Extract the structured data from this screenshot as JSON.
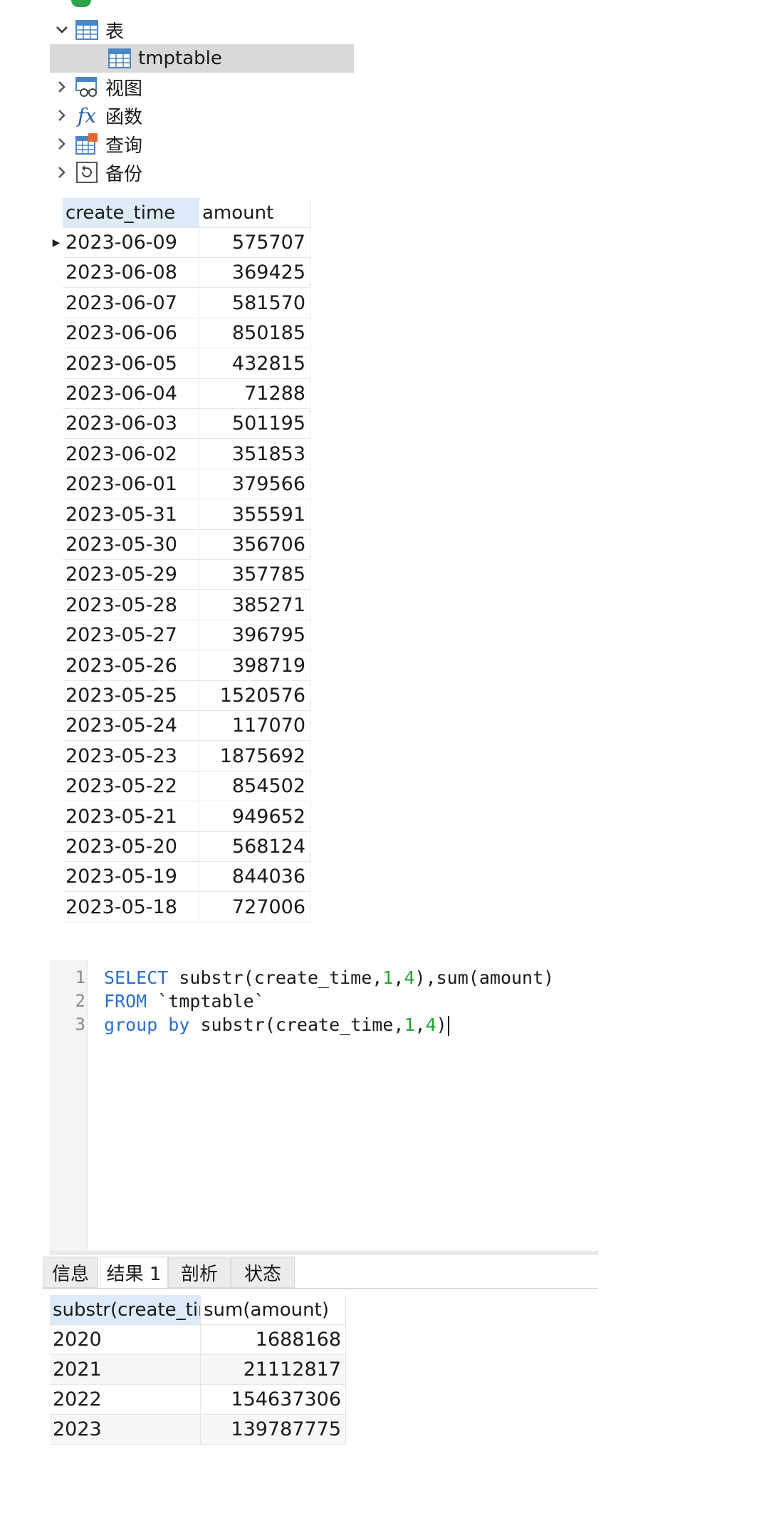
{
  "tree": {
    "tables_label": "表",
    "table_name": "tmptable",
    "views_label": "视图",
    "functions_label": "函数",
    "queries_label": "查询",
    "backups_label": "备份"
  },
  "grid": {
    "columns": [
      "create_time",
      "amount"
    ],
    "rows": [
      [
        "2023-06-09",
        "575707"
      ],
      [
        "2023-06-08",
        "369425"
      ],
      [
        "2023-06-07",
        "581570"
      ],
      [
        "2023-06-06",
        "850185"
      ],
      [
        "2023-06-05",
        "432815"
      ],
      [
        "2023-06-04",
        "71288"
      ],
      [
        "2023-06-03",
        "501195"
      ],
      [
        "2023-06-02",
        "351853"
      ],
      [
        "2023-06-01",
        "379566"
      ],
      [
        "2023-05-31",
        "355591"
      ],
      [
        "2023-05-30",
        "356706"
      ],
      [
        "2023-05-29",
        "357785"
      ],
      [
        "2023-05-28",
        "385271"
      ],
      [
        "2023-05-27",
        "396795"
      ],
      [
        "2023-05-26",
        "398719"
      ],
      [
        "2023-05-25",
        "1520576"
      ],
      [
        "2023-05-24",
        "117070"
      ],
      [
        "2023-05-23",
        "1875692"
      ],
      [
        "2023-05-22",
        "854502"
      ],
      [
        "2023-05-21",
        "949652"
      ],
      [
        "2023-05-20",
        "568124"
      ],
      [
        "2023-05-19",
        "844036"
      ],
      [
        "2023-05-18",
        "727006"
      ]
    ]
  },
  "editor": {
    "line_numbers": [
      "1",
      "2",
      "3"
    ],
    "lines": [
      [
        [
          "kw",
          "SELECT"
        ],
        [
          "txt",
          " substr(create_time,"
        ],
        [
          "num",
          "1"
        ],
        [
          "txt",
          ","
        ],
        [
          "num",
          "4"
        ],
        [
          "txt",
          "),sum(amount)"
        ]
      ],
      [
        [
          "kw",
          "FROM"
        ],
        [
          "txt",
          " `tmptable`"
        ]
      ],
      [
        [
          "kw",
          "group by"
        ],
        [
          "txt",
          " substr(create_time,"
        ],
        [
          "num",
          "1"
        ],
        [
          "txt",
          ","
        ],
        [
          "num",
          "4"
        ],
        [
          "txt",
          ")"
        ]
      ]
    ]
  },
  "result_tabs": [
    "信息",
    "结果 1",
    "剖析",
    "状态"
  ],
  "active_tab": "结果 1",
  "result": {
    "columns": [
      "substr(create_tim",
      "sum(amount)"
    ],
    "rows": [
      [
        "2020",
        "1688168"
      ],
      [
        "2021",
        "21112817"
      ],
      [
        "2022",
        "154637306"
      ],
      [
        "2023",
        "139787775"
      ]
    ]
  },
  "colors": {
    "keyword": "#2a6fd0",
    "number": "#21a52b",
    "selection": "#d9d9d9",
    "header_highlight": "#dcebf7"
  },
  "icons": [
    "chevron-down-icon",
    "table-icon",
    "chevron-right-icon",
    "view-icon",
    "function-icon",
    "query-icon",
    "backup-icon"
  ]
}
